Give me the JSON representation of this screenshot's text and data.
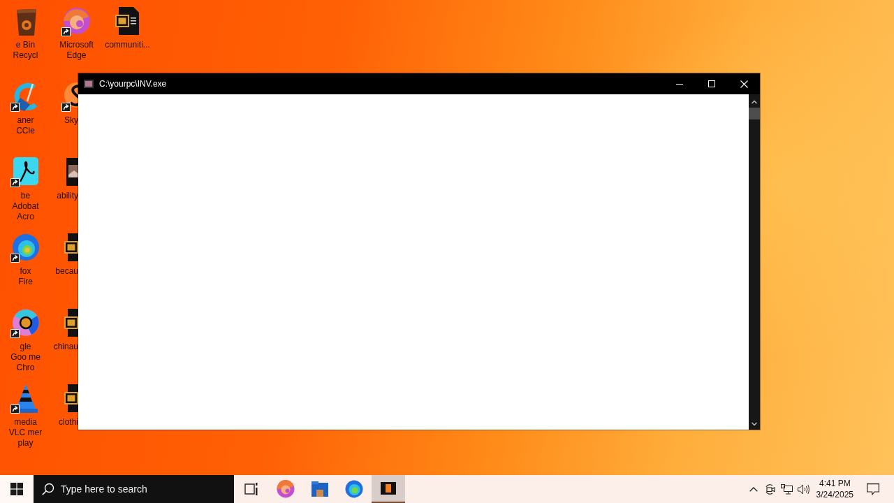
{
  "desktop": {
    "icons": [
      {
        "kind": "bin",
        "label": [
          "e Bin",
          "Recycl"
        ],
        "shortcut": false
      },
      {
        "kind": "cleaner",
        "label": [
          "aner",
          "CCle"
        ],
        "shortcut": true
      },
      {
        "kind": "reader",
        "label": [
          "be",
          "Adobat",
          "Acro"
        ],
        "shortcut": true
      },
      {
        "kind": "firefox",
        "label": [
          "fox",
          "Fire"
        ],
        "shortcut": true
      },
      {
        "kind": "chrome",
        "label": [
          "gle",
          "Goo me",
          "Chro"
        ],
        "shortcut": true
      },
      {
        "kind": "cone",
        "label": [
          "media",
          "VLC mer",
          "play"
        ],
        "shortcut": true
      },
      {
        "kind": "edge",
        "label": [
          "Microsoft",
          "Edge"
        ],
        "shortcut": true
      },
      {
        "kind": "skype",
        "label": [
          "Sky"
        ],
        "shortcut": true
      },
      {
        "kind": "image",
        "label": [
          "ability"
        ],
        "shortcut": false
      },
      {
        "kind": "document",
        "label": [
          "becau"
        ],
        "shortcut": false
      },
      {
        "kind": "document",
        "label": [
          "chinau"
        ],
        "shortcut": false
      },
      {
        "kind": "document",
        "label": [
          "clothi"
        ],
        "shortcut": false
      },
      {
        "kind": "document",
        "label": [
          "communiti..."
        ],
        "shortcut": false
      }
    ]
  },
  "window": {
    "title": "C:\\yourpc\\INV.exe"
  },
  "taskbar": {
    "search": {
      "placeholder": "Type here to search"
    },
    "apps": [
      {
        "kind": "taskview",
        "active": false
      },
      {
        "kind": "edge",
        "active": false
      },
      {
        "kind": "explorer",
        "active": false
      },
      {
        "kind": "firefox",
        "active": false
      },
      {
        "kind": "console",
        "active": true
      }
    ],
    "tray": {
      "time": "4:41 PM",
      "date": "3/24/2025"
    }
  }
}
